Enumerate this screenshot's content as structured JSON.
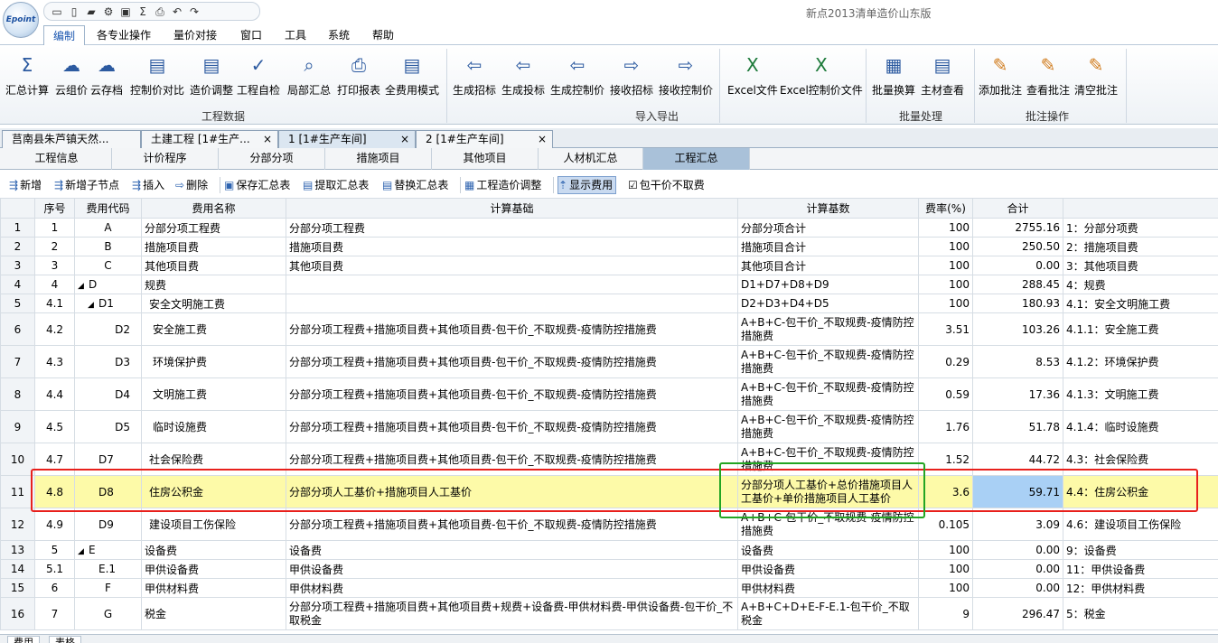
{
  "app": {
    "title": "新点2013清单造价山东版",
    "logo": "Epoint"
  },
  "qat_icons": [
    "new-doc-icon",
    "blank-doc-icon",
    "open-folder-icon",
    "tools-icon",
    "save-icon",
    "sigma-icon",
    "print-icon",
    "undo-icon",
    "redo-icon"
  ],
  "menus": [
    "编制",
    "各专业操作",
    "量价对接",
    "窗口",
    "工具",
    "系统",
    "帮助"
  ],
  "ribbon": {
    "buttons": [
      {
        "label": "汇总计算",
        "icon": "Σ"
      },
      {
        "label": "云组价",
        "icon": "☁"
      },
      {
        "label": "云存档",
        "icon": "☁"
      },
      {
        "label": "控制价对比",
        "icon": "▤"
      },
      {
        "label": "造价调整",
        "icon": "▤"
      },
      {
        "label": "工程自检",
        "icon": "✓"
      },
      {
        "label": "局部汇总",
        "icon": "⌕"
      },
      {
        "label": "打印报表",
        "icon": "⎙"
      },
      {
        "label": "全费用模式",
        "icon": "▤"
      },
      {
        "label": "生成招标",
        "icon": "⇦"
      },
      {
        "label": "生成投标",
        "icon": "⇦"
      },
      {
        "label": "生成控制价",
        "icon": "⇦"
      },
      {
        "label": "接收招标",
        "icon": "⇨"
      },
      {
        "label": "接收控制价",
        "icon": "⇨"
      },
      {
        "label": "Excel文件",
        "icon": "X"
      },
      {
        "label": "Excel控制价文件",
        "icon": "X"
      },
      {
        "label": "批量换算",
        "icon": "▦"
      },
      {
        "label": "主材查看",
        "icon": "▤"
      },
      {
        "label": "添加批注",
        "icon": "✎"
      },
      {
        "label": "查看批注",
        "icon": "✎"
      },
      {
        "label": "清空批注",
        "icon": "✎"
      }
    ],
    "groups": [
      "工程数据",
      "导入导出",
      "批量处理",
      "批注操作"
    ]
  },
  "doc_tabs": [
    "莒南县朱芦镇天然...",
    "土建工程 [1#生产...",
    "1 [1#生产车间]",
    "2 [1#生产车间]"
  ],
  "doc_tab_close": "×",
  "section_tabs": [
    "工程信息",
    "计价程序",
    "分部分项",
    "措施项目",
    "其他项目",
    "人材机汇总",
    "工程汇总"
  ],
  "toolbar": {
    "add": "新增",
    "add_child": "新增子节点",
    "insert": "插入",
    "delete": "删除",
    "save_summary": "保存汇总表",
    "extract_summary": "提取汇总表",
    "replace_summary": "替换汇总表",
    "cost_adjust": "工程造价调整",
    "show_fee": "显示费用",
    "lump_sum": "包干价不取费"
  },
  "table": {
    "headers": [
      "",
      "序号",
      "费用代码",
      "费用名称",
      "计算基础",
      "计算基数",
      "费率(%)",
      "合计",
      ""
    ],
    "rows": [
      {
        "rn": "1",
        "seq": "1",
        "code": "A",
        "name": "分部分项工程费",
        "basis": "分部分项工程费",
        "base": "分部分项合计",
        "rate": "100",
        "total": "2755.16",
        "note": "1：分部分项费"
      },
      {
        "rn": "2",
        "seq": "2",
        "code": "B",
        "name": "措施项目费",
        "basis": "措施项目费",
        "base": "措施项目合计",
        "rate": "100",
        "total": "250.50",
        "note": "2：措施项目费"
      },
      {
        "rn": "3",
        "seq": "3",
        "code": "C",
        "name": "其他项目费",
        "basis": "其他项目费",
        "base": "其他项目合计",
        "rate": "100",
        "total": "0.00",
        "note": "3：其他项目费"
      },
      {
        "rn": "4",
        "seq": "4",
        "code": "D",
        "name": "规费",
        "basis": "",
        "base": "D1+D7+D8+D9",
        "rate": "100",
        "total": "288.45",
        "note": "4：规费"
      },
      {
        "rn": "5",
        "seq": "4.1",
        "code": "D1",
        "name": "安全文明施工费",
        "basis": "",
        "base": "D2+D3+D4+D5",
        "rate": "100",
        "total": "180.93",
        "note": "4.1：安全文明施工费"
      },
      {
        "rn": "6",
        "seq": "4.2",
        "code": "D2",
        "name": "安全施工费",
        "basis": "分部分项工程费+措施项目费+其他项目费-包干价_不取规费-疫情防控措施费",
        "base": "A+B+C-包干价_不取规费-疫情防控措施费",
        "rate": "3.51",
        "total": "103.26",
        "note": "4.1.1：安全施工费"
      },
      {
        "rn": "7",
        "seq": "4.3",
        "code": "D3",
        "name": "环境保护费",
        "basis": "分部分项工程费+措施项目费+其他项目费-包干价_不取规费-疫情防控措施费",
        "base": "A+B+C-包干价_不取规费-疫情防控措施费",
        "rate": "0.29",
        "total": "8.53",
        "note": "4.1.2：环境保护费"
      },
      {
        "rn": "8",
        "seq": "4.4",
        "code": "D4",
        "name": "文明施工费",
        "basis": "分部分项工程费+措施项目费+其他项目费-包干价_不取规费-疫情防控措施费",
        "base": "A+B+C-包干价_不取规费-疫情防控措施费",
        "rate": "0.59",
        "total": "17.36",
        "note": "4.1.3：文明施工费"
      },
      {
        "rn": "9",
        "seq": "4.5",
        "code": "D5",
        "name": "临时设施费",
        "basis": "分部分项工程费+措施项目费+其他项目费-包干价_不取规费-疫情防控措施费",
        "base": "A+B+C-包干价_不取规费-疫情防控措施费",
        "rate": "1.76",
        "total": "51.78",
        "note": "4.1.4：临时设施费"
      },
      {
        "rn": "10",
        "seq": "4.7",
        "code": "D7",
        "name": "社会保险费",
        "basis": "分部分项工程费+措施项目费+其他项目费-包干价_不取规费-疫情防控措施费",
        "base": "A+B+C-包干价_不取规费-疫情防控措施费",
        "rate": "1.52",
        "total": "44.72",
        "note": "4.3：社会保险费"
      },
      {
        "rn": "11",
        "seq": "4.8",
        "code": "D8",
        "name": "住房公积金",
        "basis": "分部分项人工基价+措施项目人工基价",
        "base": "分部分项人工基价+总价措施项目人工基价+单价措施项目人工基价",
        "rate": "3.6",
        "total": "59.71",
        "note": "4.4：住房公积金"
      },
      {
        "rn": "12",
        "seq": "4.9",
        "code": "D9",
        "name": "建设项目工伤保险",
        "basis": "分部分项工程费+措施项目费+其他项目费-包干价_不取规费-疫情防控措施费",
        "base": "A+B+C-包干价_不取规费-疫情防控措施费",
        "rate": "0.105",
        "total": "3.09",
        "note": "4.6：建设项目工伤保险"
      },
      {
        "rn": "13",
        "seq": "5",
        "code": "E",
        "name": "设备费",
        "basis": "设备费",
        "base": "设备费",
        "rate": "100",
        "total": "0.00",
        "note": "9：设备费"
      },
      {
        "rn": "14",
        "seq": "5.1",
        "code": "E.1",
        "name": "甲供设备费",
        "basis": "甲供设备费",
        "base": "甲供设备费",
        "rate": "100",
        "total": "0.00",
        "note": "11：甲供设备费"
      },
      {
        "rn": "15",
        "seq": "6",
        "code": "F",
        "name": "甲供材料费",
        "basis": "甲供材料费",
        "base": "甲供材料费",
        "rate": "100",
        "total": "0.00",
        "note": "12：甲供材料费"
      },
      {
        "rn": "16",
        "seq": "7",
        "code": "G",
        "name": "税金",
        "basis": "分部分项工程费+措施项目费+其他项目费+规费+设备费-甲供材料费-甲供设备费-包干价_不取税金",
        "base": "A+B+C+D+E-F-E.1-包干价_不取税金",
        "rate": "9",
        "total": "296.47",
        "note": "5：税金"
      }
    ]
  },
  "bottom_tabs": [
    "费用",
    "表格"
  ],
  "colors": {
    "highlight_row": "#fdfaa8",
    "selected_cell": "#a9d0f5",
    "red_box": "#e8201c",
    "green_box": "#23a523"
  }
}
